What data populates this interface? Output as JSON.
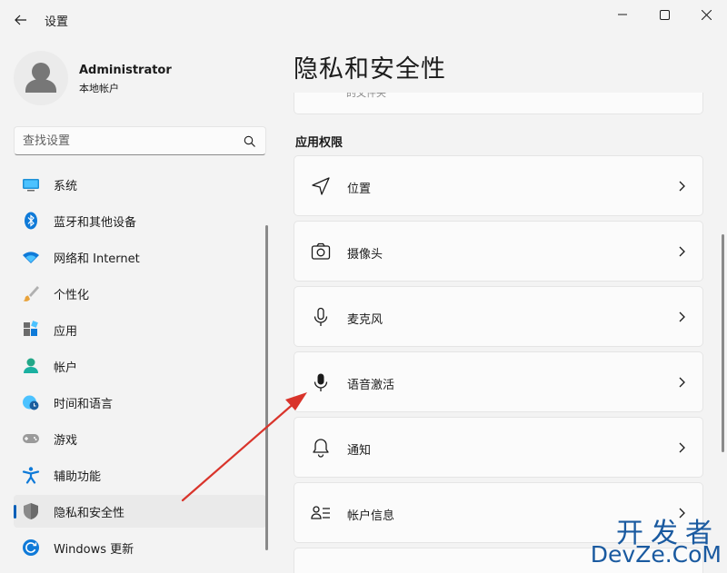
{
  "window": {
    "title": "设置",
    "back_icon": "back-arrow-icon",
    "buttons": [
      "minimize-icon",
      "maximize-icon",
      "close-icon"
    ]
  },
  "user": {
    "name": "Administrator",
    "account_type": "本地帐户"
  },
  "search": {
    "placeholder": "查找设置",
    "icon": "search-icon"
  },
  "sidebar": {
    "items": [
      {
        "label": "系统",
        "icon": "system-display-icon"
      },
      {
        "label": "蓝牙和其他设备",
        "icon": "bluetooth-icon"
      },
      {
        "label": "网络和 Internet",
        "icon": "wifi-icon"
      },
      {
        "label": "个性化",
        "icon": "paintbrush-icon"
      },
      {
        "label": "应用",
        "icon": "apps-icon"
      },
      {
        "label": "帐户",
        "icon": "account-person-icon"
      },
      {
        "label": "时间和语言",
        "icon": "globe-clock-icon"
      },
      {
        "label": "游戏",
        "icon": "gamepad-icon"
      },
      {
        "label": "辅助功能",
        "icon": "accessibility-icon"
      },
      {
        "label": "隐私和安全性",
        "icon": "shield-icon",
        "active": true
      },
      {
        "label": "Windows 更新",
        "icon": "windows-update-icon"
      }
    ]
  },
  "main": {
    "title": "隐私和安全性",
    "partial_card_text": "的文件夹",
    "section_title": "应用权限",
    "cards": [
      {
        "label": "位置",
        "icon": "location-arrow-icon"
      },
      {
        "label": "摄像头",
        "icon": "camera-icon"
      },
      {
        "label": "麦克风",
        "icon": "microphone-icon"
      },
      {
        "label": "语音激活",
        "icon": "voice-activation-microphone-icon"
      },
      {
        "label": "通知",
        "icon": "bell-icon"
      },
      {
        "label": "帐户信息",
        "icon": "account-info-icon"
      }
    ]
  },
  "watermark": {
    "line1": "开发者",
    "line2": "DevZe.CoM"
  },
  "colors": {
    "accent": "#005fb8",
    "annotation_arrow": "#d9342b",
    "watermark": "#1a5aa0"
  }
}
